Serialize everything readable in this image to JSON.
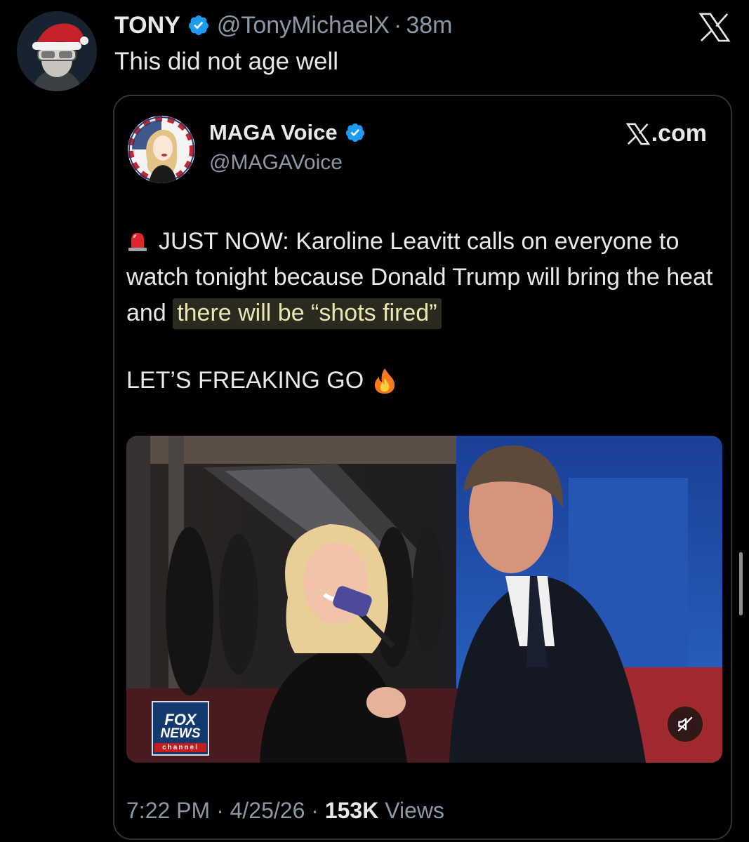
{
  "outer_tweet": {
    "author_name": "TONY",
    "handle": "@TonyMichaelX",
    "separator": "·",
    "time_ago": "38m",
    "text": "This did not age well"
  },
  "quoted_tweet": {
    "author_name": "MAGA Voice",
    "handle": "@MAGAVoice",
    "source_label": ".com",
    "body_part1": "JUST NOW: Karoline Leavitt calls on everyone to watch tonight because Donald Trump will bring the heat and ",
    "body_highlight": "there will be “shots fired”",
    "body_line2": "LET’S FREAKING GO",
    "video": {
      "logo_top": "FOX",
      "logo_mid": "NEWS",
      "logo_bottom": "channel"
    },
    "meta": {
      "time": "7:22 PM",
      "sep1": "·",
      "date": "4/25/26",
      "sep2": "·",
      "views_count": "153K",
      "views_label": "Views"
    }
  },
  "icons": {
    "verified": "verified-badge-icon",
    "x_logo": "x-logo-icon",
    "siren": "police-light-emoji",
    "fire": "fire-emoji",
    "mute": "speaker-muted-icon"
  },
  "colors": {
    "background": "#000000",
    "text_primary": "#e7e9ea",
    "text_secondary": "#8b98a5",
    "verified_blue": "#1d9bf0",
    "card_border": "#2f3336",
    "highlight_bg": "#2a2a1e"
  }
}
